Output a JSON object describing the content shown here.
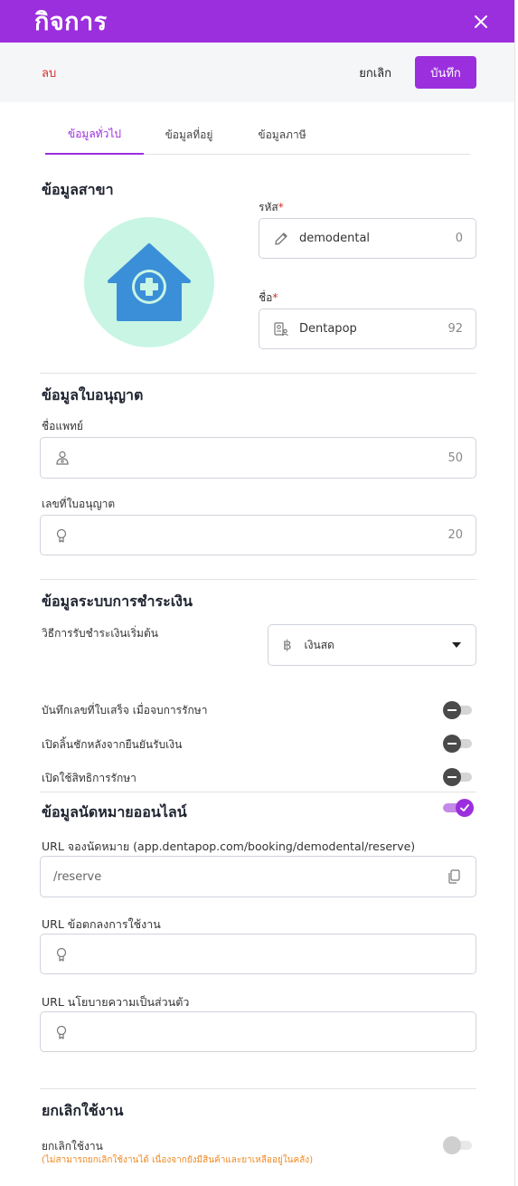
{
  "header": {
    "title": "กิจการ",
    "close_icon": "close-icon"
  },
  "actions": {
    "delete": "ลบ",
    "cancel": "ยกเลิก",
    "save": "บันทึก"
  },
  "tabs": [
    {
      "label": "ข้อมูลทั่วไป",
      "active": true
    },
    {
      "label": "ข้อมูลที่อยู่",
      "active": false
    },
    {
      "label": "ข้อมูลภาษี",
      "active": false
    }
  ],
  "branch": {
    "title": "ข้อมูลสาขา",
    "logo_icon": "medical-house-icon",
    "code": {
      "label": "รหัส",
      "required": "*",
      "value": "demodental",
      "count": "0",
      "icon": "pencil-icon"
    },
    "name": {
      "label": "ชื่อ",
      "required": "*",
      "value": "Dentapop",
      "count": "92",
      "icon": "id-card-icon"
    }
  },
  "license": {
    "title": "ข้อมูลใบอนุญาต",
    "doctor": {
      "label": "ชื่อแพทย์",
      "value": "",
      "count": "50",
      "icon": "doctor-icon"
    },
    "number": {
      "label": "เลขที่ใบอนุญาต",
      "value": "",
      "count": "20",
      "icon": "certificate-icon"
    }
  },
  "payment": {
    "title": "ข้อมูลระบบการชำระเงิน",
    "method_label": "วิธีการรับชำระเงินเริ่มต้น",
    "method_value": "เงินสด",
    "method_icon": "baht-icon",
    "toggles": [
      {
        "label": "บันทึกเลขที่ใบเสร็จ เมื่อจบการรักษา",
        "on": false
      },
      {
        "label": "เปิดลิ้นชักหลังจากยืนยันรับเงิน",
        "on": false
      },
      {
        "label": "เปิดใช้สิทธิการรักษา",
        "on": false
      }
    ]
  },
  "online": {
    "title": "ข้อมูลนัดหมายออนไลน์",
    "enabled": true,
    "booking": {
      "label": "URL จองนัดหมาย (app.dentapop.com/booking/demodental/reserve)",
      "value": "/reserve",
      "icon": "copy-icon"
    },
    "terms": {
      "label": "URL ข้อตกลงการใช้งาน",
      "value": "",
      "icon": "certificate-icon"
    },
    "privacy": {
      "label": "URL นโยบายความเป็นส่วนตัว",
      "value": "",
      "icon": "certificate-icon"
    }
  },
  "deactivate": {
    "title": "ยกเลิกใช้งาน",
    "label": "ยกเลิกใช้งาน",
    "warning": "(ไม่สามารถยกเลิกใช้งานได้ เนื่องจากยังมีสินค้าและยาเหลืออยู่ในคลัง)",
    "on": false,
    "disabled": true
  },
  "colors": {
    "primary": "#9b2fdd",
    "danger": "#d32f2f",
    "warning": "#f08a24",
    "logo_bg": "#c8f5e4",
    "logo_fg": "#3a8fd8"
  }
}
